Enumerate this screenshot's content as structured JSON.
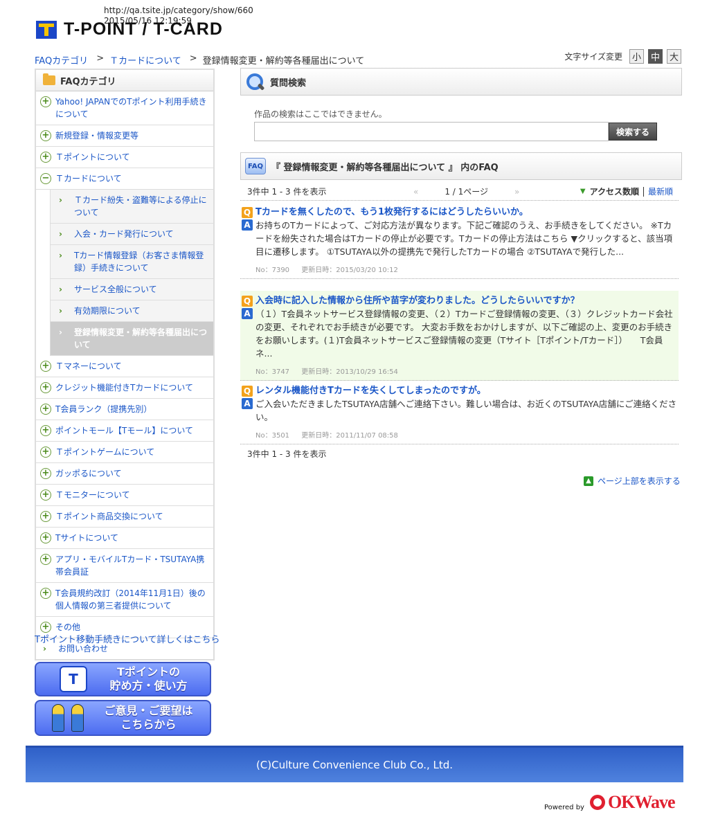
{
  "archive": {
    "url": "http://qa.tsite.jp/category/show/660",
    "timestamp": "2015/05/16  12:19:59"
  },
  "logo": {
    "text": "T-POINT / T-CARD"
  },
  "breadcrumb": [
    {
      "label": "FAQカテゴリ",
      "link": true
    },
    {
      "label": "Ｔカードについて",
      "link": true
    },
    {
      "label": "登録情報変更・解約等各種届出について",
      "link": false
    }
  ],
  "font_size": {
    "label": "文字サイズ変更",
    "small": "小",
    "medium": "中",
    "large": "大",
    "selected": "medium"
  },
  "sidebar": {
    "title": "FAQカテゴリ",
    "items": [
      {
        "label": "Yahoo! JAPANでのTポイント利用手続きについて",
        "type": "plus"
      },
      {
        "label": "新規登録・情報変更等",
        "type": "plus"
      },
      {
        "label": "Ｔポイントについて",
        "type": "plus"
      },
      {
        "label": "Ｔカードについて",
        "type": "minus"
      }
    ],
    "sub_items": [
      {
        "label": "Ｔカード紛失・盗難等による停止について"
      },
      {
        "label": "入会・カード発行について"
      },
      {
        "label": "Tカード情報登録（お客さま情報登録）手続きについて"
      },
      {
        "label": "サービス全般について"
      },
      {
        "label": "有効期限について"
      },
      {
        "label": "登録情報変更・解約等各種届出について",
        "current": true
      }
    ],
    "items_after": [
      {
        "label": "Ｔマネーについて",
        "type": "plus"
      },
      {
        "label": "クレジット機能付きTカードについて",
        "type": "plus"
      },
      {
        "label": "T会員ランク（提携先別）",
        "type": "plus"
      },
      {
        "label": "ポイントモール【Tモール】について",
        "type": "plus"
      },
      {
        "label": "Ｔポイントゲームについて",
        "type": "plus"
      },
      {
        "label": "ガッポるについて",
        "type": "plus"
      },
      {
        "label": "Ｔモニターについて",
        "type": "plus"
      },
      {
        "label": "Ｔポイント商品交換について",
        "type": "plus"
      },
      {
        "label": "Tサイトについて",
        "type": "plus"
      },
      {
        "label": "アプリ・モバイルTカード・TSUTAYA携帯会員証",
        "type": "plus"
      },
      {
        "label": "T会員規約改訂（2014年11月1日）後の個人情報の第三者提供について",
        "type": "plus"
      },
      {
        "label": "その他",
        "type": "plus"
      },
      {
        "label": "お問い合わせ",
        "type": "chevron"
      }
    ]
  },
  "move_link": "Tポイント移動手続きについて詳しくはこちら",
  "banners": {
    "how_to": {
      "line1": "Tポイントの",
      "line2": "貯め方・使い方",
      "icon": "t-point-hand-icon"
    },
    "feedback": {
      "line1": "ご意見・ご要望は",
      "line2": "こちらから",
      "icon": "kids-icon"
    }
  },
  "search": {
    "title": "質問検索",
    "note": "作品の検索はここではできません。",
    "input_value": "",
    "button": "検索する"
  },
  "faq_section": {
    "badge": "FAQ",
    "title": "『 登録情報変更・解約等各種届出について 』 内のFAQ",
    "count_text": "3件中 1 - 3 件を表示",
    "prev": "«",
    "page": "1 / 1ページ",
    "next": "»",
    "sort_active": "アクセス数順",
    "sort_other": "最新順",
    "bottom_count": "3件中 1 - 3 件を表示"
  },
  "faqs": [
    {
      "question": "Tカードを無くしたので、もう1枚発行するにはどうしたらいいか。",
      "answer": "お持ちのTカードによって、ご対応方法が異なります。下記ご確認のうえ、お手続きをしてください。 ※Tカードを紛失された場合はTカードの停止が必要です。Tカードの停止方法はこちら ▼クリックすると、該当項目に遷移します。 ①TSUTAYA以外の提携先で発行したTカードの場合 ②TSUTAYAで発行した...",
      "no": "No：7390",
      "updated": "更新日時：2015/03/20 10:12"
    },
    {
      "question": "入会時に記入した情報から住所や苗字が変わりました。どうしたらいいですか？",
      "answer": "（１）T会員ネットサービス登録情報の変更、（２）Tカードご登録情報の変更、（３）クレジットカード会社の変更、それぞれでお手続きが必要です。 大変お手数をおかけしますが、以下ご確認の上、変更のお手続きをお願いします。(１)T会員ネットサービスご登録情報の変更（Tサイト［Tポイント/Tカード］）　　T会員ネ...",
      "no": "No：3747",
      "updated": "更新日時：2013/10/29 16:54"
    },
    {
      "question": "レンタル機能付きTカードを失くしてしまったのですが。",
      "answer": "ご入会いただきましたTSUTAYA店舗へご連絡下さい。難しい場合は、お近くのTSUTAYA店舗にご連絡ください。",
      "no": "No：3501",
      "updated": "更新日時：2011/11/07 08:58"
    }
  ],
  "q_mark": "Q",
  "a_mark": "A",
  "page_top": "ページ上部を表示する",
  "footer": "(C)Culture Convenience Club Co., Ltd.",
  "powered": {
    "label": "Powered by",
    "brand": "OKWave"
  },
  "colors": {
    "link": "#1a56c7",
    "footer": "#3b6fd4",
    "q_badge": "#f3a21c",
    "a_badge": "#2a6ad0",
    "accent_green": "#4a8a1a"
  }
}
